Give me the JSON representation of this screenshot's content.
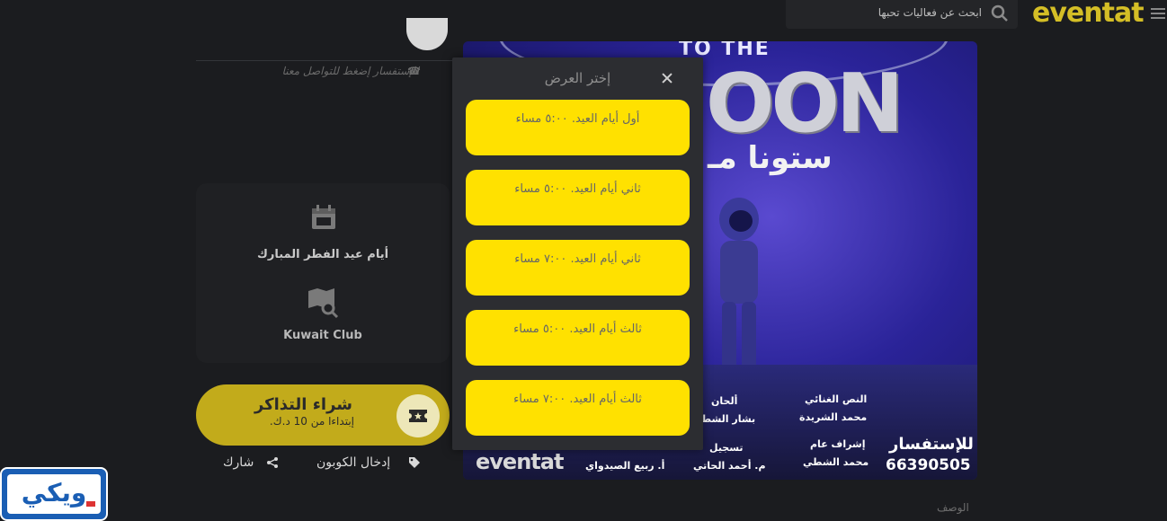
{
  "header": {
    "logo": "eventat",
    "search_placeholder": "ابحث عن فعاليات تحبها"
  },
  "contact": {
    "text": "للإستفسار إضغط للتواصل معنا"
  },
  "info": {
    "date": "أيام عيد الفطر المبارك",
    "venue": "Kuwait Club"
  },
  "buy": {
    "title": "شراء التذاكر",
    "subtitle": "إبتداءا من 10 د.ك."
  },
  "actions": {
    "share": "شارك",
    "coupon": "إدخال الكوبون"
  },
  "poster": {
    "top_text": "TO THE",
    "moon_text": "OON",
    "arabic_title": "ستونا مـ",
    "credits": [
      {
        "role": "النص الغنائي",
        "name": "محمد الشريدة"
      },
      {
        "role": "ألحان",
        "name": "بشار الشطـ"
      },
      {
        "role": "إشراف عام",
        "name": "محمد الشطي"
      },
      {
        "role": "تسجيل",
        "name": "م. أحمد الحاتي"
      },
      {
        "role": "",
        "name": "أ. ربيع الصيدواي"
      }
    ],
    "inquiry_label": "للإستفسار",
    "inquiry_number": "66390505",
    "logo": "eventat"
  },
  "modal": {
    "title": "إختر العرض",
    "options": [
      "أول أيام العيد. ٥:٠٠ مساء",
      "ثاني أيام العيد. ٥:٠٠ مساء",
      "ثاني أيام العيد. ٧:٠٠ مساء",
      "ثالث أيام العيد. ٥:٠٠ مساء",
      "ثالث أيام العيد. ٧:٠٠ مساء"
    ]
  },
  "description_label": "الوصف",
  "badge": {
    "text": "ويكي"
  }
}
